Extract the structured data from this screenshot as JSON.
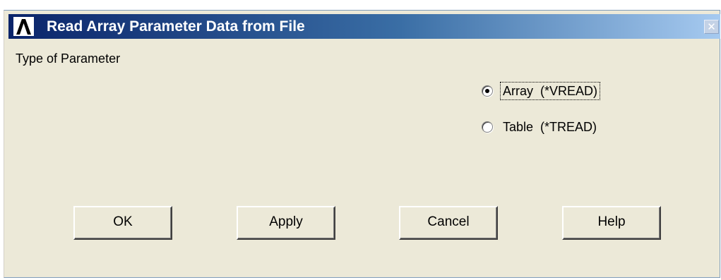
{
  "window": {
    "title": "Read Array Parameter Data from File",
    "close_glyph": "✕",
    "app_icon": "ansys-logo-icon"
  },
  "section": {
    "label": "Type of Parameter"
  },
  "options": [
    {
      "label": "Array  (*VREAD)",
      "selected": true
    },
    {
      "label": "Table  (*TREAD)",
      "selected": false
    }
  ],
  "buttons": {
    "ok": "OK",
    "apply": "Apply",
    "cancel": "Cancel",
    "help": "Help"
  },
  "colors": {
    "dialog_bg": "#ece9d8",
    "title_start": "#0a246a",
    "title_end": "#a6caf0"
  }
}
